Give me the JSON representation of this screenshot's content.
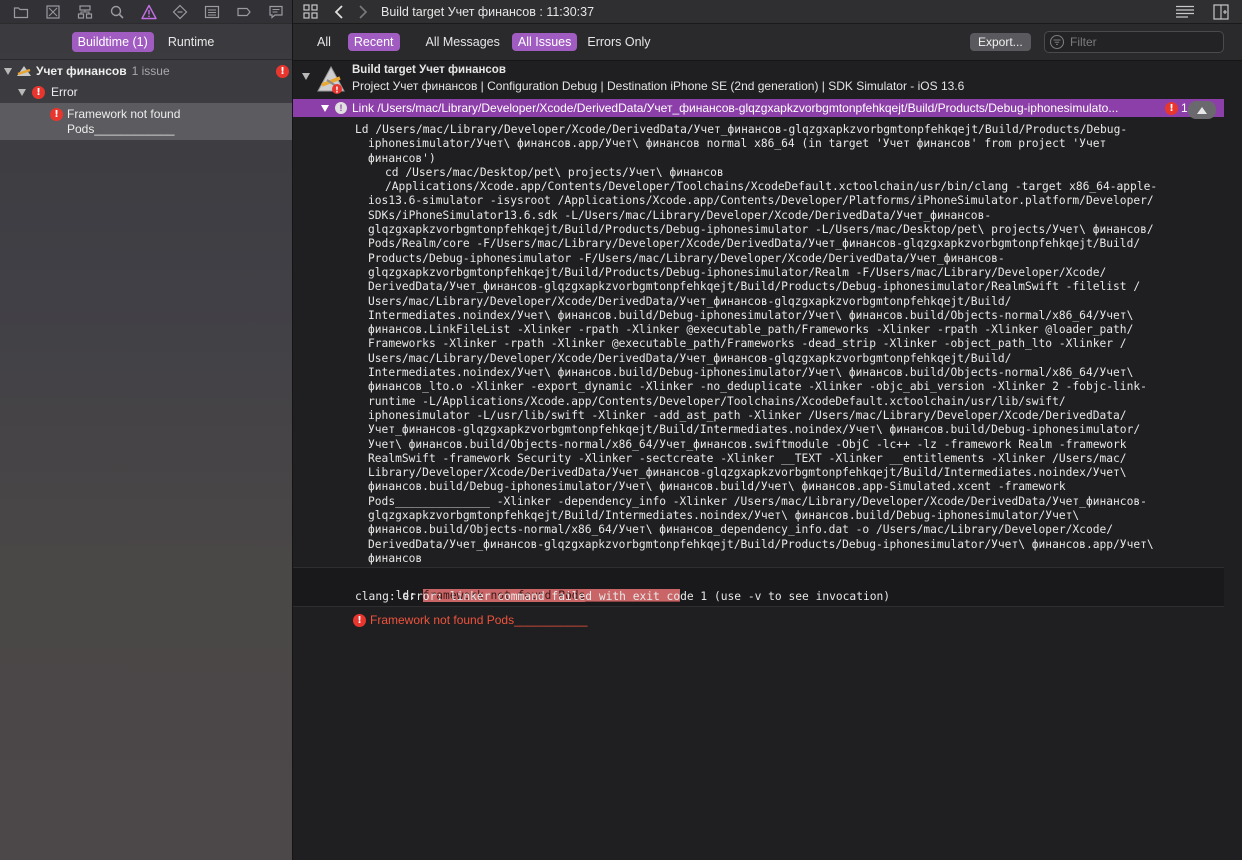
{
  "navigator": {
    "icons": [
      "folder-icon",
      "source-control-icon",
      "hierarchy-icon",
      "search-icon",
      "issue-warning-icon",
      "test-diamond-icon",
      "debug-list-icon",
      "breakpoint-icon",
      "report-bubble-icon"
    ],
    "scope": {
      "buildtime": "Buildtime (1)",
      "runtime": "Runtime"
    },
    "tree": {
      "project_name": "Учет финансов",
      "project_count": "1 issue",
      "group": "Error",
      "issue_line1": "Framework not found",
      "issue_line2": "Pods____________"
    }
  },
  "toolbar": {
    "title": "Build target Учет финансов : 11:30:37"
  },
  "filterbar": {
    "scope_all": "All",
    "scope_recent": "Recent",
    "all_messages": "All Messages",
    "all_issues": "All Issues",
    "errors_only": "Errors Only",
    "export": "Export...",
    "filter_placeholder": "Filter"
  },
  "log": {
    "build_title": "Build target Учет финансов",
    "build_subtitle": "Project Учет финансов | Configuration Debug | Destination iPhone SE (2nd generation) | SDK Simulator - iOS 13.6",
    "link_row": "Link /Users/mac/Library/Developer/Xcode/DerivedData/Учет_финансов-glqzgxapkzvorbgmtonpfehkqejt/Build/Products/Debug-iphonesimulato...",
    "link_badge": "1",
    "cmd_lines": [
      "Ld /Users/mac/Library/Developer/Xcode/DerivedData/Учет_финансов-glqzgxapkzvorbgmtonpfehkqejt/Build/Products/Debug-",
      "iphonesimulator/Учет\\ финансов.app/Учет\\ финансов normal x86_64 (in target 'Учет финансов' from project 'Учет",
      "финансов')",
      "cd /Users/mac/Desktop/pet\\ projects/Учет\\ финансов",
      "/Applications/Xcode.app/Contents/Developer/Toolchains/XcodeDefault.xctoolchain/usr/bin/clang -target x86_64-apple-",
      "ios13.6-simulator -isysroot /Applications/Xcode.app/Contents/Developer/Platforms/iPhoneSimulator.platform/Developer/",
      "SDKs/iPhoneSimulator13.6.sdk -L/Users/mac/Library/Developer/Xcode/DerivedData/Учет_финансов-",
      "glqzgxapkzvorbgmtonpfehkqejt/Build/Products/Debug-iphonesimulator -L/Users/mac/Desktop/pet\\ projects/Учет\\ финансов/",
      "Pods/Realm/core -F/Users/mac/Library/Developer/Xcode/DerivedData/Учет_финансов-glqzgxapkzvorbgmtonpfehkqejt/Build/",
      "Products/Debug-iphonesimulator -F/Users/mac/Library/Developer/Xcode/DerivedData/Учет_финансов-",
      "glqzgxapkzvorbgmtonpfehkqejt/Build/Products/Debug-iphonesimulator/Realm -F/Users/mac/Library/Developer/Xcode/",
      "DerivedData/Учет_финансов-glqzgxapkzvorbgmtonpfehkqejt/Build/Products/Debug-iphonesimulator/RealmSwift -filelist /",
      "Users/mac/Library/Developer/Xcode/DerivedData/Учет_финансов-glqzgxapkzvorbgmtonpfehkqejt/Build/",
      "Intermediates.noindex/Учет\\ финансов.build/Debug-iphonesimulator/Учет\\ финансов.build/Objects-normal/x86_64/Учет\\",
      "финансов.LinkFileList -Xlinker -rpath -Xlinker @executable_path/Frameworks -Xlinker -rpath -Xlinker @loader_path/",
      "Frameworks -Xlinker -rpath -Xlinker @executable_path/Frameworks -dead_strip -Xlinker -object_path_lto -Xlinker /",
      "Users/mac/Library/Developer/Xcode/DerivedData/Учет_финансов-glqzgxapkzvorbgmtonpfehkqejt/Build/",
      "Intermediates.noindex/Учет\\ финансов.build/Debug-iphonesimulator/Учет\\ финансов.build/Objects-normal/x86_64/Учет\\",
      "финансов_lto.o -Xlinker -export_dynamic -Xlinker -no_deduplicate -Xlinker -objc_abi_version -Xlinker 2 -fobjc-link-",
      "runtime -L/Applications/Xcode.app/Contents/Developer/Toolchains/XcodeDefault.xctoolchain/usr/lib/swift/",
      "iphonesimulator -L/usr/lib/swift -Xlinker -add_ast_path -Xlinker /Users/mac/Library/Developer/Xcode/DerivedData/",
      "Учет_финансов-glqzgxapkzvorbgmtonpfehkqejt/Build/Intermediates.noindex/Учет\\ финансов.build/Debug-iphonesimulator/",
      "Учет\\ финансов.build/Objects-normal/x86_64/Учет_финансов.swiftmodule -ObjC -lc++ -lz -framework Realm -framework",
      "RealmSwift -framework Security -Xlinker -sectcreate -Xlinker __TEXT -Xlinker __entitlements -Xlinker /Users/mac/",
      "Library/Developer/Xcode/DerivedData/Учет_финансов-glqzgxapkzvorbgmtonpfehkqejt/Build/Intermediates.noindex/Учет\\",
      "финансов.build/Debug-iphonesimulator/Учет\\ финансов.build/Учет\\ финансов.app-Simulated.xcent -framework",
      "Pods______________ -Xlinker -dependency_info -Xlinker /Users/mac/Library/Developer/Xcode/DerivedData/Учет_финансов-",
      "glqzgxapkzvorbgmtonpfehkqejt/Build/Intermediates.noindex/Учет\\ финансов.build/Debug-iphonesimulator/Учет\\",
      "финансов.build/Objects-normal/x86_64/Учет\\ финансов_dependency_info.dat -o /Users/mac/Library/Developer/Xcode/",
      "DerivedData/Учет_финансов-glqzgxapkzvorbgmtonpfehkqejt/Build/Products/Debug-iphonesimulator/Учет\\ финансов.app/Учет\\",
      "финансов"
    ],
    "ld_prefix": "ld: ",
    "ld_error": "framework not found Pods______________",
    "clang_error": "clang: error: linker command failed with exit code 1 (use -v to see invocation)",
    "final_error": "Framework not found Pods___________"
  },
  "colors": {
    "accent_purple": "#a15cc2",
    "link_row_purple": "#8d3fa9",
    "error_red": "#e8362f",
    "error_text": "#f0533d"
  }
}
